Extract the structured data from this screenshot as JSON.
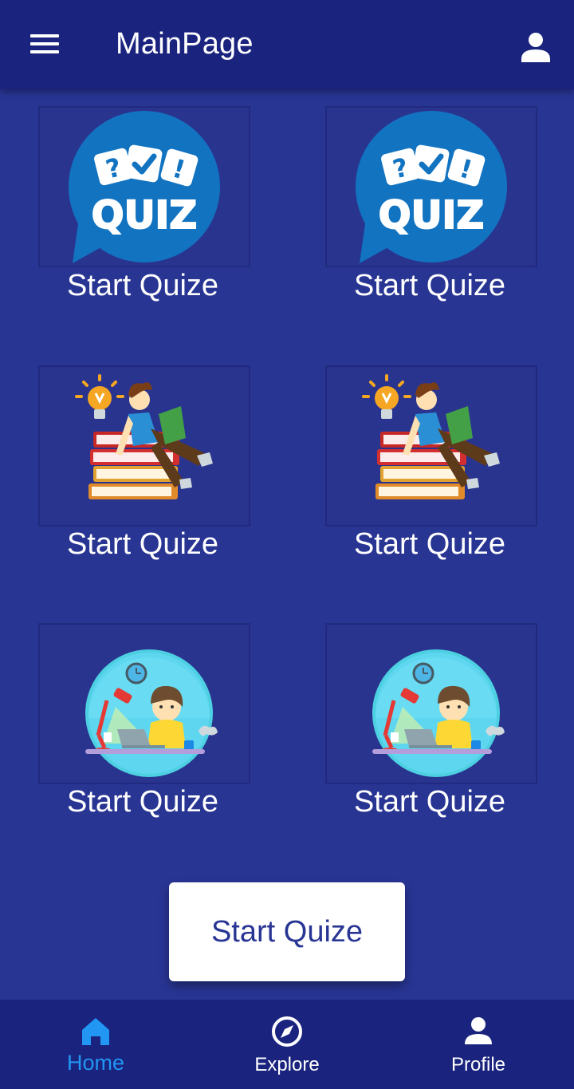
{
  "app_bar": {
    "title": "MainPage",
    "menu_icon": "menu-icon",
    "account_icon": "person-icon"
  },
  "grid": {
    "items": [
      {
        "label": "Start Quize",
        "image": "quiz-speech-bubble"
      },
      {
        "label": "Start Quize",
        "image": "quiz-speech-bubble"
      },
      {
        "label": "Start Quize",
        "image": "student-reading-on-books"
      },
      {
        "label": "Start Quize",
        "image": "student-reading-on-books"
      },
      {
        "label": "Start Quize",
        "image": "boy-working-on-laptop"
      },
      {
        "label": "Start Quize",
        "image": "boy-working-on-laptop"
      }
    ]
  },
  "start_button": {
    "label": "Start Quize"
  },
  "bottom_nav": {
    "items": [
      {
        "label": "Home",
        "icon": "home-icon",
        "active": true
      },
      {
        "label": "Explore",
        "icon": "compass-icon",
        "active": false
      },
      {
        "label": "Profile",
        "icon": "person-icon",
        "active": false
      }
    ]
  },
  "colors": {
    "background": "#283593",
    "app_bar": "#1a237e",
    "active_nav": "#2196f3",
    "button_text": "#283593",
    "quiz_bubble": "#1273c0"
  }
}
